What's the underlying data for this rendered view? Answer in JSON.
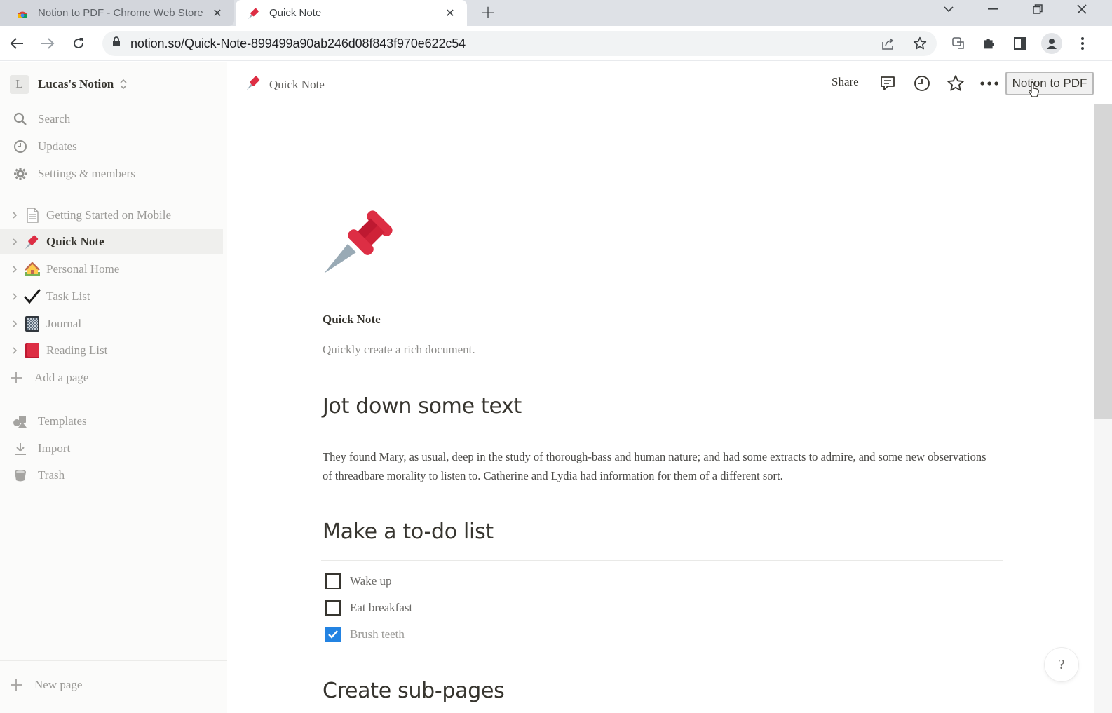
{
  "browser": {
    "tabs": [
      {
        "title": "Notion to PDF - Chrome Web Store",
        "icon": "chrome-web-store-icon",
        "active": false
      },
      {
        "title": "Quick Note",
        "icon": "pushpin-icon",
        "active": true
      }
    ],
    "close_glyph": "✕",
    "new_tab_glyph": "+",
    "url": "notion.so/Quick-Note-899499a90ab246d08f843f970e622c54"
  },
  "sidebar": {
    "workspace_initial": "L",
    "workspace_name": "Lucas's Notion",
    "nav": [
      {
        "label": "Search",
        "icon": "search-icon"
      },
      {
        "label": "Updates",
        "icon": "clock-icon"
      },
      {
        "label": "Settings & members",
        "icon": "gear-icon"
      }
    ],
    "pages": [
      {
        "label": "Getting Started on Mobile",
        "icon": "document-icon",
        "selected": false
      },
      {
        "label": "Quick Note",
        "icon": "pushpin-icon",
        "selected": true
      },
      {
        "label": "Personal Home",
        "icon": "house-icon",
        "selected": false
      },
      {
        "label": "Task List",
        "icon": "checkmark-icon",
        "selected": false
      },
      {
        "label": "Journal",
        "icon": "notebook-icon",
        "selected": false
      },
      {
        "label": "Reading List",
        "icon": "red-book-icon",
        "selected": false
      }
    ],
    "add_page": "Add a page",
    "tools": [
      {
        "label": "Templates",
        "icon": "templates-icon"
      },
      {
        "label": "Import",
        "icon": "import-icon"
      },
      {
        "label": "Trash",
        "icon": "trash-icon"
      }
    ],
    "new_page": "New page"
  },
  "topbar": {
    "breadcrumb": "Quick Note",
    "share_label": "Share",
    "notion_to_pdf_label": "Notion to PDF"
  },
  "page": {
    "title": "Quick Note",
    "subtitle": "Quickly create a rich document.",
    "sections": [
      {
        "heading": "Jot down some text"
      },
      {
        "heading": "Make a to-do list"
      },
      {
        "heading": "Create sub-pages"
      }
    ],
    "paragraph": "They found Mary, as usual, deep in the study of thorough-bass and human nature; and had some extracts to admire, and some new observations of threadbare morality to listen to. Catherine and Lydia had information for them of a different sort.",
    "todos": [
      {
        "label": "Wake up",
        "checked": false
      },
      {
        "label": "Eat breakfast",
        "checked": false
      },
      {
        "label": "Brush teeth",
        "checked": true
      }
    ],
    "help_label": "?"
  },
  "colors": {
    "accent_blue": "#2383e2",
    "pin_red": "#dd2e44",
    "sidebar_bg": "#fbfbfa"
  }
}
